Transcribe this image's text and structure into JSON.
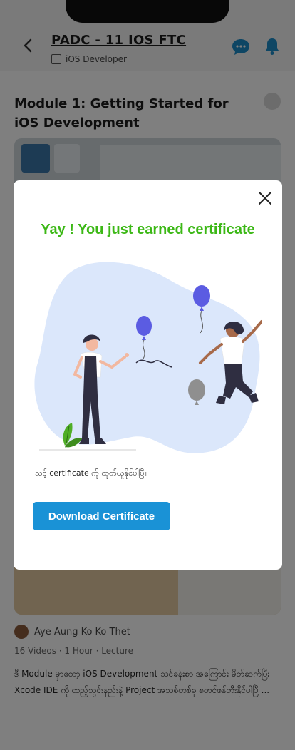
{
  "header": {
    "title": "PADC - 11 IOS FTC",
    "subtitle": "iOS Developer"
  },
  "module": {
    "title": "Module 1: Getting Started for iOS Development"
  },
  "lesson": {
    "author": "Aye Aung Ko Ko Thet",
    "meta": "16 Videos   ·   1 Hour   ·   Lecture",
    "description": "ဒီ Module မှာတော့ iOS Development သင်ခန်းစာ အကြောင်း မိတ်ဆက်ပြီး Xcode IDE ကို ထည့်သွင်းနည်းနဲ့ Project အသစ်တစ်ခု စတင်ဖန်တီးနိုင်ပါပြီ ..."
  },
  "dialog": {
    "title": "Yay ! You just earned certificate",
    "message": "သင့် certificate ကို ထုတ်ယူနိုင်ပါပြီ။",
    "download_label": "Download Certificate"
  },
  "colors": {
    "title_green": "#3cb816",
    "button_blue": "#1a92d6",
    "blob": "#dbe7fb",
    "balloon": "#5b5ce2"
  },
  "icons": [
    "back-icon",
    "chat-icon",
    "bell-icon",
    "close-icon"
  ]
}
